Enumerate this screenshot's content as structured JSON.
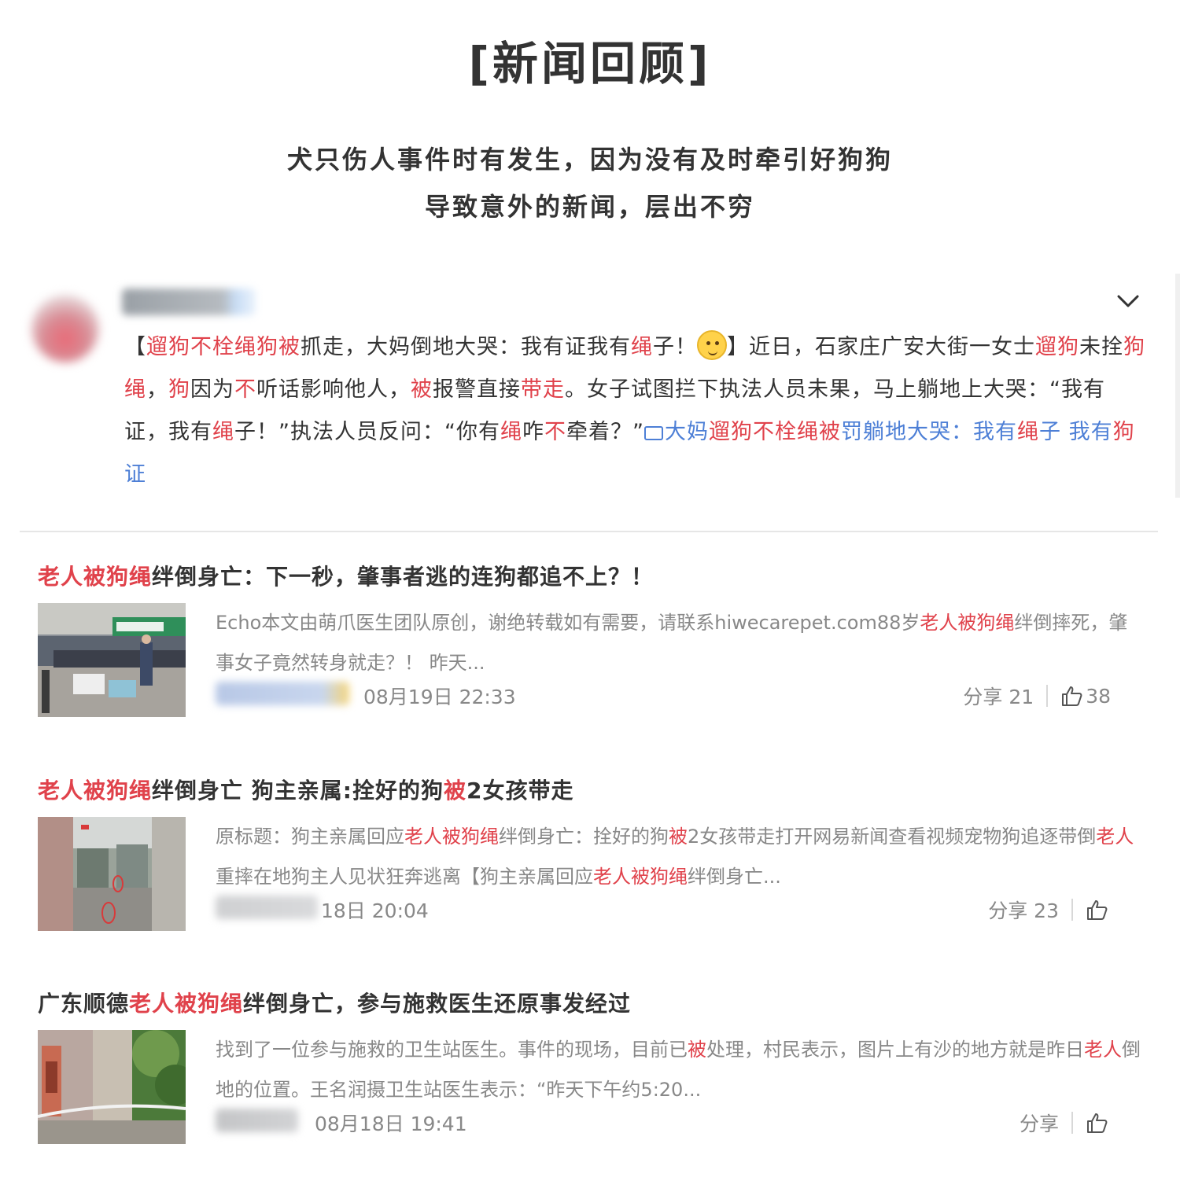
{
  "header": {
    "title": "[新闻回顾]",
    "subtitle_line1": "犬只伤人事件时有发生，因为没有及时牵引好狗狗",
    "subtitle_line2": "导致意外的新闻，层出不穷"
  },
  "post": {
    "icons": {
      "collapse": "chevron-down-icon",
      "emoji": "dog-emoji-icon",
      "video": "video-icon"
    },
    "segments": [
      {
        "t": "【",
        "c": ""
      },
      {
        "t": "遛狗不栓绳狗被",
        "c": "hl"
      },
      {
        "t": "抓走，大妈倒地大哭：我有证我有",
        "c": ""
      },
      {
        "t": "绳",
        "c": "hl"
      },
      {
        "t": "子！",
        "c": ""
      },
      {
        "t": "",
        "c": "emoji"
      },
      {
        "t": "】近日，石家庄广安大街一女士",
        "c": ""
      },
      {
        "t": "遛狗",
        "c": "hl"
      },
      {
        "t": "未拴",
        "c": ""
      },
      {
        "t": "狗绳",
        "c": "hl"
      },
      {
        "t": "，",
        "c": ""
      },
      {
        "t": "狗",
        "c": "hl"
      },
      {
        "t": "因为",
        "c": ""
      },
      {
        "t": "不",
        "c": "hl"
      },
      {
        "t": "听话影响他人，",
        "c": ""
      },
      {
        "t": "被",
        "c": "hl"
      },
      {
        "t": "报警直接",
        "c": ""
      },
      {
        "t": "带走",
        "c": "hl"
      },
      {
        "t": "。女子试图拦下执法人员未果，马上躺地上大哭：“我有证，我有",
        "c": ""
      },
      {
        "t": "绳",
        "c": "hl"
      },
      {
        "t": "子！”执法人员反问：“你有",
        "c": ""
      },
      {
        "t": "绳",
        "c": "hl"
      },
      {
        "t": "咋",
        "c": ""
      },
      {
        "t": "不",
        "c": "hl"
      },
      {
        "t": "牵着？”",
        "c": ""
      },
      {
        "t": "",
        "c": "video"
      },
      {
        "t": "大妈",
        "c": "lk"
      },
      {
        "t": "遛狗不栓绳被",
        "c": "hl"
      },
      {
        "t": "罚躺地大哭：我有",
        "c": "lk"
      },
      {
        "t": "绳",
        "c": "hl"
      },
      {
        "t": "子 我有",
        "c": "lk"
      },
      {
        "t": "狗",
        "c": "hl"
      },
      {
        "t": "证",
        "c": "lk"
      }
    ]
  },
  "news": [
    {
      "title_segments": [
        {
          "t": "老人被狗绳",
          "c": "hl"
        },
        {
          "t": "绊倒身亡：下一秒，肇事者逃的连狗都追不上？！",
          "c": ""
        }
      ],
      "snippet_segments": [
        {
          "t": "Echo本文由萌爪医生团队原创，谢绝转载如有需要，请联系hiwecarepet.com88岁",
          "c": ""
        },
        {
          "t": "老人被狗绳",
          "c": "hl"
        },
        {
          "t": "绊倒摔死，肇事女子竟然转身就走？！ 昨天...",
          "c": ""
        }
      ],
      "date": "08月19日 22:33",
      "share": "分享 21",
      "likes": "38"
    },
    {
      "title_segments": [
        {
          "t": "老人被狗绳",
          "c": "hl"
        },
        {
          "t": "绊倒身亡 狗主亲属:拴好的狗",
          "c": ""
        },
        {
          "t": "被",
          "c": "hl"
        },
        {
          "t": "2女孩带走",
          "c": ""
        }
      ],
      "snippet_segments": [
        {
          "t": "原标题：狗主亲属回应",
          "c": ""
        },
        {
          "t": "老人被狗绳",
          "c": "hl"
        },
        {
          "t": "绊倒身亡：拴好的狗",
          "c": ""
        },
        {
          "t": "被",
          "c": "hl"
        },
        {
          "t": "2女孩带走打开网易新闻查看视频宠物狗追逐带倒",
          "c": ""
        },
        {
          "t": "老人",
          "c": "hl"
        },
        {
          "t": "重摔在地狗主人见状狂奔逃离【狗主亲属回应",
          "c": ""
        },
        {
          "t": "老人被狗绳",
          "c": "hl"
        },
        {
          "t": "绊倒身亡...",
          "c": ""
        }
      ],
      "date": "18日 20:04",
      "share": "分享 23",
      "likes": ""
    },
    {
      "title_segments": [
        {
          "t": "广东顺德",
          "c": ""
        },
        {
          "t": "老人被狗绳",
          "c": "hl"
        },
        {
          "t": "绊倒身亡，参与施救医生还原事发经过",
          "c": ""
        }
      ],
      "snippet_segments": [
        {
          "t": "找到了一位参与施救的卫生站医生。事件的现场，目前已",
          "c": ""
        },
        {
          "t": "被",
          "c": "hl"
        },
        {
          "t": "处理，村民表示，图片上有沙的地方就是昨日",
          "c": ""
        },
        {
          "t": "老人",
          "c": "hl"
        },
        {
          "t": "倒地的位置。王名润摄卫生站医生表示：“昨天下午约5:20...",
          "c": ""
        }
      ],
      "date": "08月18日 19:41",
      "share": "分享",
      "likes": ""
    }
  ]
}
